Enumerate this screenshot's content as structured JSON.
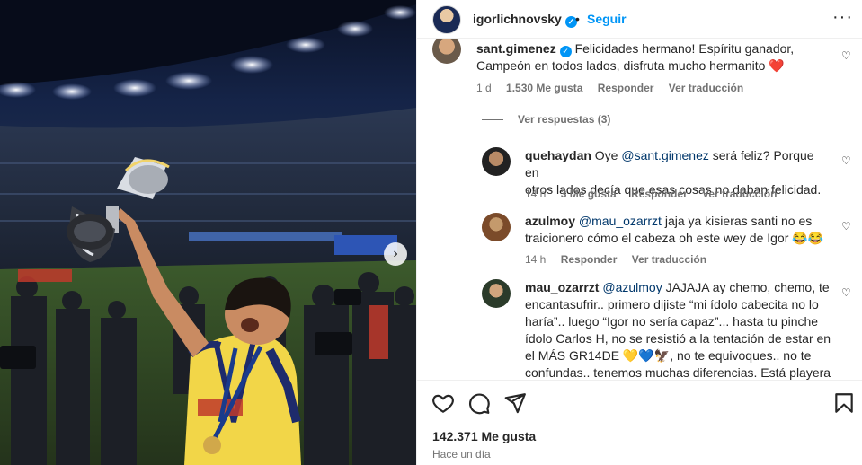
{
  "post": {
    "username": "igorlichnovsky",
    "dot": "•",
    "follow_label": "Seguir",
    "more_label": "···",
    "likes": "142.371 Me gusta",
    "time": "Hace un día"
  },
  "comments": [
    {
      "user": "sant.gimenez",
      "verified": true,
      "text": "Felicidades hermano! Espíritu ganador, Campeón en todos lados, disfruta mucho hermanito ❤️",
      "line1": "Felicidades hermano! Espíritu ganador,",
      "line2": "Campeón en todos lados, disfruta mucho hermanito ❤️",
      "age": "1 d",
      "likes": "1.530 Me gusta",
      "reply": "Responder",
      "translate": "Ver traducción"
    },
    {
      "user": "quehaydan",
      "pre": "Oye ",
      "mention": "@sant.gimenez",
      "post": " será feliz? Porque en",
      "line2": "otros lados decía que esas cosas no daban felicidad.",
      "age": "14 h",
      "likes": "3 Me gusta",
      "reply": "Responder",
      "translate": "Ver traducción"
    },
    {
      "user": "azulmoy",
      "mention": "@mau_ozarrzt",
      "post": " jaja ya kisieras santi no es",
      "line2": "traicionero cómo el cabeza oh este wey de Igor 😂😂",
      "age": "14 h",
      "reply": "Responder",
      "translate": "Ver traducción"
    },
    {
      "user": "mau_ozarrzt",
      "mention": "@azulmoy",
      "post": " JAJAJA ay chemo, chemo, te",
      "line2": "encantasufrir.. primero dijiste “mi ídolo cabecita no lo",
      "line3": "haría”.. luego “Igor no sería capaz”... hasta tu pinche",
      "line4": "ídolo Carlos H, no se resistió a la tentación de estar en",
      "line5": "el MÁS GR14DE 💛💙🦅, no te equivoques.. no te",
      "line6": "confundas.. tenemos muchas diferencias. Está playera"
    }
  ],
  "view_replies": "Ver respuestas (3)",
  "icons": {
    "heart": "heart-icon",
    "comment": "comment-icon",
    "share": "share-icon",
    "save": "bookmark-icon",
    "next": "chevron-right-icon"
  },
  "colors": {
    "link": "#0095f6",
    "mention": "#00376b",
    "muted": "#737373",
    "like_heart": "#ed4956"
  }
}
